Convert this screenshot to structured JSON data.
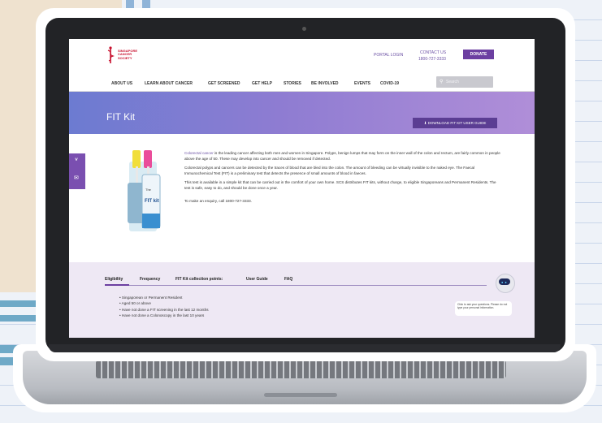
{
  "site": {
    "logo_text": "SINGAPORE CANCER SOCIETY",
    "top_links": [
      "PORTAL LOGIN",
      "CONTACT US"
    ],
    "phone": "1800-727-3333",
    "donate_label": "DONATE"
  },
  "nav": {
    "items": [
      "ABOUT US",
      "LEARN ABOUT CANCER",
      "GET SCREENED",
      "GET HELP",
      "STORIES",
      "BE INVOLVED",
      "EVENTS",
      "COVID-19"
    ],
    "search_placeholder": "Search"
  },
  "banner": {
    "title": "FIT Kit",
    "download_label": "DOWNLOAD FIT KIT USER GUIDE"
  },
  "product": {
    "label_top": "The",
    "label_main": "FIT kit"
  },
  "content": {
    "link_text": "Colorectal cancer",
    "para1_rest": " is the leading cancer affecting both men and women in Singapore. Polyps, benign lumps that may form on the inner wall of the colon and rectum, are fairly common in people above the age of 50. These may develop into cancer and should be removed if detected.",
    "para2": "Colorectal polyps and cancers can be detected by the traces of blood that are bled into the colon. The amount of bleeding can be virtually invisible to the naked eye. The Faecal Immunochemical Test (FIT) is a preliminary test that detects the presence of small amounts of blood in faeces.",
    "para3": "This test is available in a simple kit that can be carried out in the comfort of your own home. SCS distributes FIT kits, without charge, to eligible Singaporeans and Permanent Residents. The test is safe, easy to do, and should be done once a year.",
    "para4": "To make an enquiry, call 1800-727-3333."
  },
  "tabs": [
    "Eligibility",
    "Frequency",
    "FIT Kit collection points:",
    "User Guide",
    "FAQ"
  ],
  "eligibility": [
    "Singaporean or Permanent Resident",
    "Aged 50 or above",
    "Have not done a FIT screening in the last 12 months",
    "Have not done a Colonoscopy in the last 10 years"
  ],
  "chatbot": {
    "message": "Click to ask your questions. Please do not type your personal information."
  },
  "colors": {
    "brand_purple": "#6c3fa1",
    "banner_start": "#6c7bd1",
    "banner_end": "#b08ed8",
    "logo_red": "#c8102e"
  }
}
